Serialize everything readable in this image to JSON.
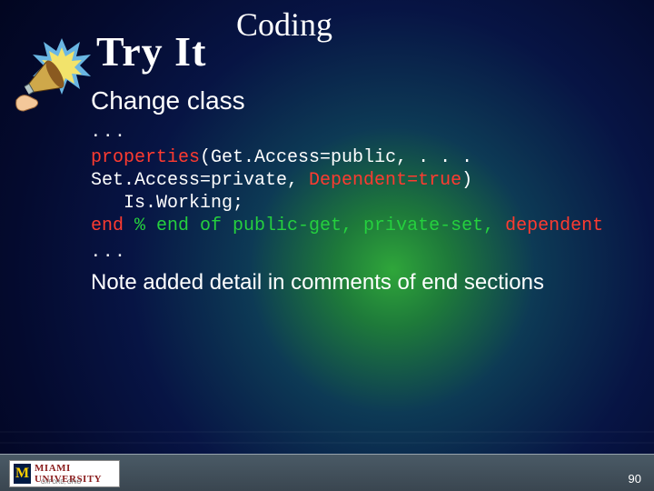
{
  "header": {
    "title": "Coding",
    "tryit": "Try It"
  },
  "body": {
    "heading": "Change class",
    "dots_top": ". . .",
    "dots_bottom": ". . .",
    "code": {
      "l1a": "properties",
      "l1b": "(Get.Access=public, . . .",
      "l2a": "Set.Access=private, ",
      "l2b": "Dependent=true",
      "l2c": ")",
      "l3": "   Is.Working;",
      "l4a": "end ",
      "l4b": "% end of public-get, private-set, ",
      "l4c": "dependent"
    },
    "note": "Note added detail in comments of end sections"
  },
  "footer": {
    "slidenum": "90",
    "logo_m": "M",
    "logo_text": "MIAMI UNIVERSITY",
    "logo_sub": "OXFORD, OHIO"
  }
}
